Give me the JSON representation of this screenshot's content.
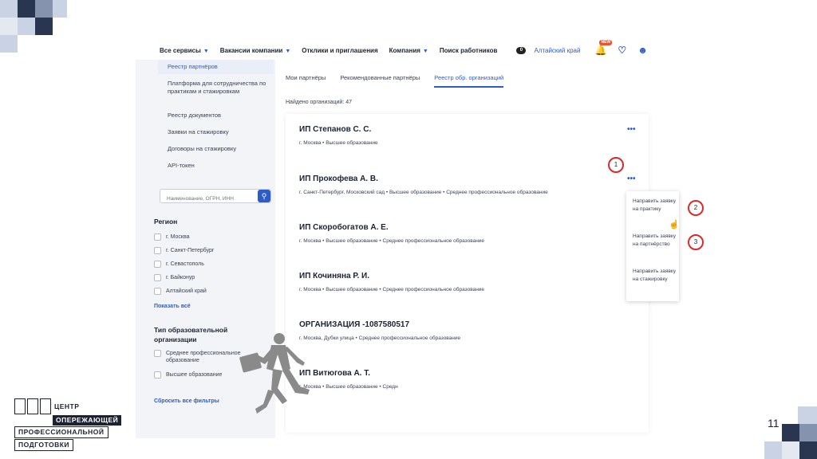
{
  "nav": {
    "items": [
      "Все сервисы",
      "Вакансии компании",
      "Отклики и приглашения",
      "Компания",
      "Поиск работников"
    ],
    "dropdown_items": [
      true,
      true,
      false,
      true,
      false
    ],
    "counter": "0",
    "region": "Алтайский край",
    "notif_badge": "NEW"
  },
  "sidebar": {
    "links": [
      "Реестр партнёров",
      "Платформа для сотрудничества по практикам и стажировкам",
      "Реестр документов",
      "Заявки на стажировку",
      "Договоры на стажировку",
      "API-токен"
    ],
    "search_placeholder": "Наименование, ОГРН, ИНН",
    "region_title": "Регион",
    "regions": [
      "г. Москва",
      "г. Санкт-Петербург",
      "г. Севастополь",
      "г. Байконур",
      "Алтайский край"
    ],
    "show_all": "Показать всё",
    "edu_type_title": "Тип образовательной организации",
    "edu_types": [
      "Среднее профессиональное образование",
      "Высшее образование"
    ],
    "reset": "Сбросить все фильтры"
  },
  "main": {
    "tabs": [
      "Мои партнёры",
      "Рекомендованные партнёры",
      "Реестр обр. организаций"
    ],
    "active_tab": 2,
    "found": "Найдено организаций: 47",
    "orgs": [
      {
        "name": "ИП Степанов С. С.",
        "meta": "г. Москва  •  Высшее образование"
      },
      {
        "name": "ИП Прокофева А. В.",
        "meta": "г. Санкт-Петербург, Московский сад  •  Высшее образование  •  Среднее профессиональное образование"
      },
      {
        "name": "ИП Скоробогатов А. Е.",
        "meta": "г. Москва  •  Высшее образование  •  Среднее профессиональное образование"
      },
      {
        "name": "ИП Кочиняна Р. И.",
        "meta": "г. Москва  •  Высшее образование  •  Среднее профессиональное образование"
      },
      {
        "name": "ОРГАНИЗАЦИЯ -1087580517",
        "meta": "г. Москва, Дубки улица  •  Среднее профессиональное образование"
      },
      {
        "name": "ИП Витюгова А. Т.",
        "meta": "г. Москва  •  Высшее образование  •  Средн"
      }
    ],
    "more": "•••",
    "dropdown": [
      "Направить заявку на практику",
      "Направить заявку на партнёрство",
      "Направить заявку на стажировку"
    ]
  },
  "markers": [
    "1",
    "2",
    "3"
  ],
  "logo": {
    "line1": "ЦЕНТР",
    "line2": "ОПЕРЕЖАЮЩЕЙ",
    "line3": "ПРОФЕССИОНАЛЬНОЙ",
    "line4": "ПОДГОТОВКИ"
  },
  "page_number": "11",
  "colors": {
    "accent": "#2d5cc8",
    "marker": "#d92b2b",
    "deco_dark": "#2a3550",
    "deco_light": "#c9d3e3"
  }
}
